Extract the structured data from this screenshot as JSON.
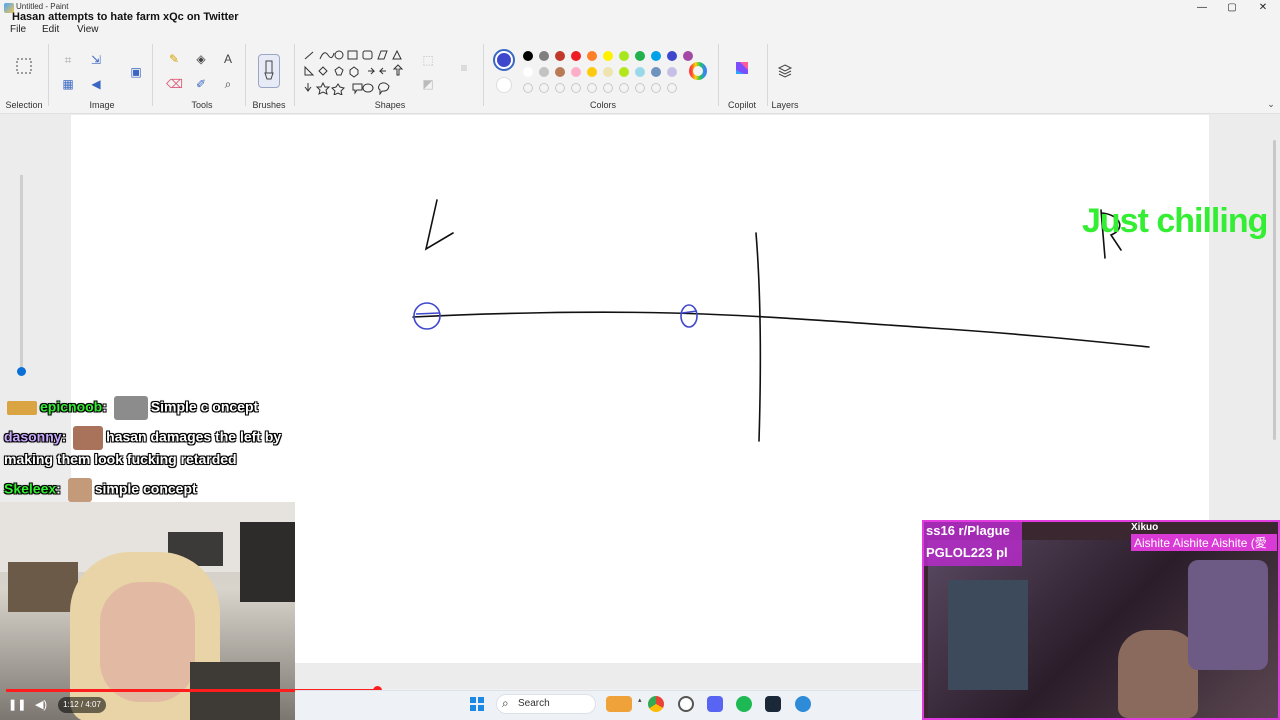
{
  "window": {
    "app_title": "Untitled - Paint",
    "stream_title": "Hasan attempts to hate farm xQc on Twitter",
    "controls": {
      "minimize": "—",
      "maximize": "▢",
      "close": "✕"
    }
  },
  "menu": {
    "file": "File",
    "edit": "Edit",
    "view": "View"
  },
  "ribbon": {
    "groups": {
      "selection": "Selection",
      "image": "Image",
      "tools": "Tools",
      "brushes": "Brushes",
      "shapes": "Shapes",
      "colors": "Colors",
      "copilot": "Copilot",
      "layers": "Layers"
    },
    "tool_glyphs": {
      "pencil": "✎",
      "fill": "◈",
      "text": "A",
      "eraser": "⌫",
      "picker": "✐",
      "magnifier": "⌕"
    },
    "palette_row1": [
      "#000000",
      "#7f7f7f",
      "#c0392b",
      "#ed1c24",
      "#ff7f27",
      "#fff200",
      "#a8e61d",
      "#22b14c",
      "#00a2e8",
      "#3f48cc",
      "#a349a4"
    ],
    "palette_row2": [
      "#ffffff",
      "#c3c3c3",
      "#b97a57",
      "#ffaec9",
      "#ffc90e",
      "#efe4b0",
      "#b5e61d",
      "#99d9ea",
      "#7092be",
      "#c8bfe7"
    ],
    "selected_color": "#3f48cc"
  },
  "overlay": {
    "label": "Just chilling"
  },
  "chat": {
    "messages": [
      {
        "user": "epicnoob",
        "user_color": "#33ee33",
        "text": "Simple c oncept"
      },
      {
        "user": "dasonny",
        "user_color": "#c9a8ff",
        "text": "hasan damages the left by"
      },
      {
        "user": "",
        "user_color": "#ffffff",
        "text": "making them look fucking retarded"
      },
      {
        "user": "Skeleex",
        "user_color": "#33ee33",
        "text": "simple concept"
      }
    ],
    "separator": ":"
  },
  "player": {
    "time": "1:12 / 4:07",
    "progress": 0.405,
    "play_glyph": "❚❚",
    "volume_glyph": "🔊"
  },
  "taskbar": {
    "search_label": "Search",
    "search_glyph": "⌕"
  },
  "cam2": {
    "name": "Xikuo",
    "song": "Aishite Aishite Aishite (愛",
    "rank": "ss16 r/Plague",
    "rank2": "PGLOL223 pl"
  }
}
